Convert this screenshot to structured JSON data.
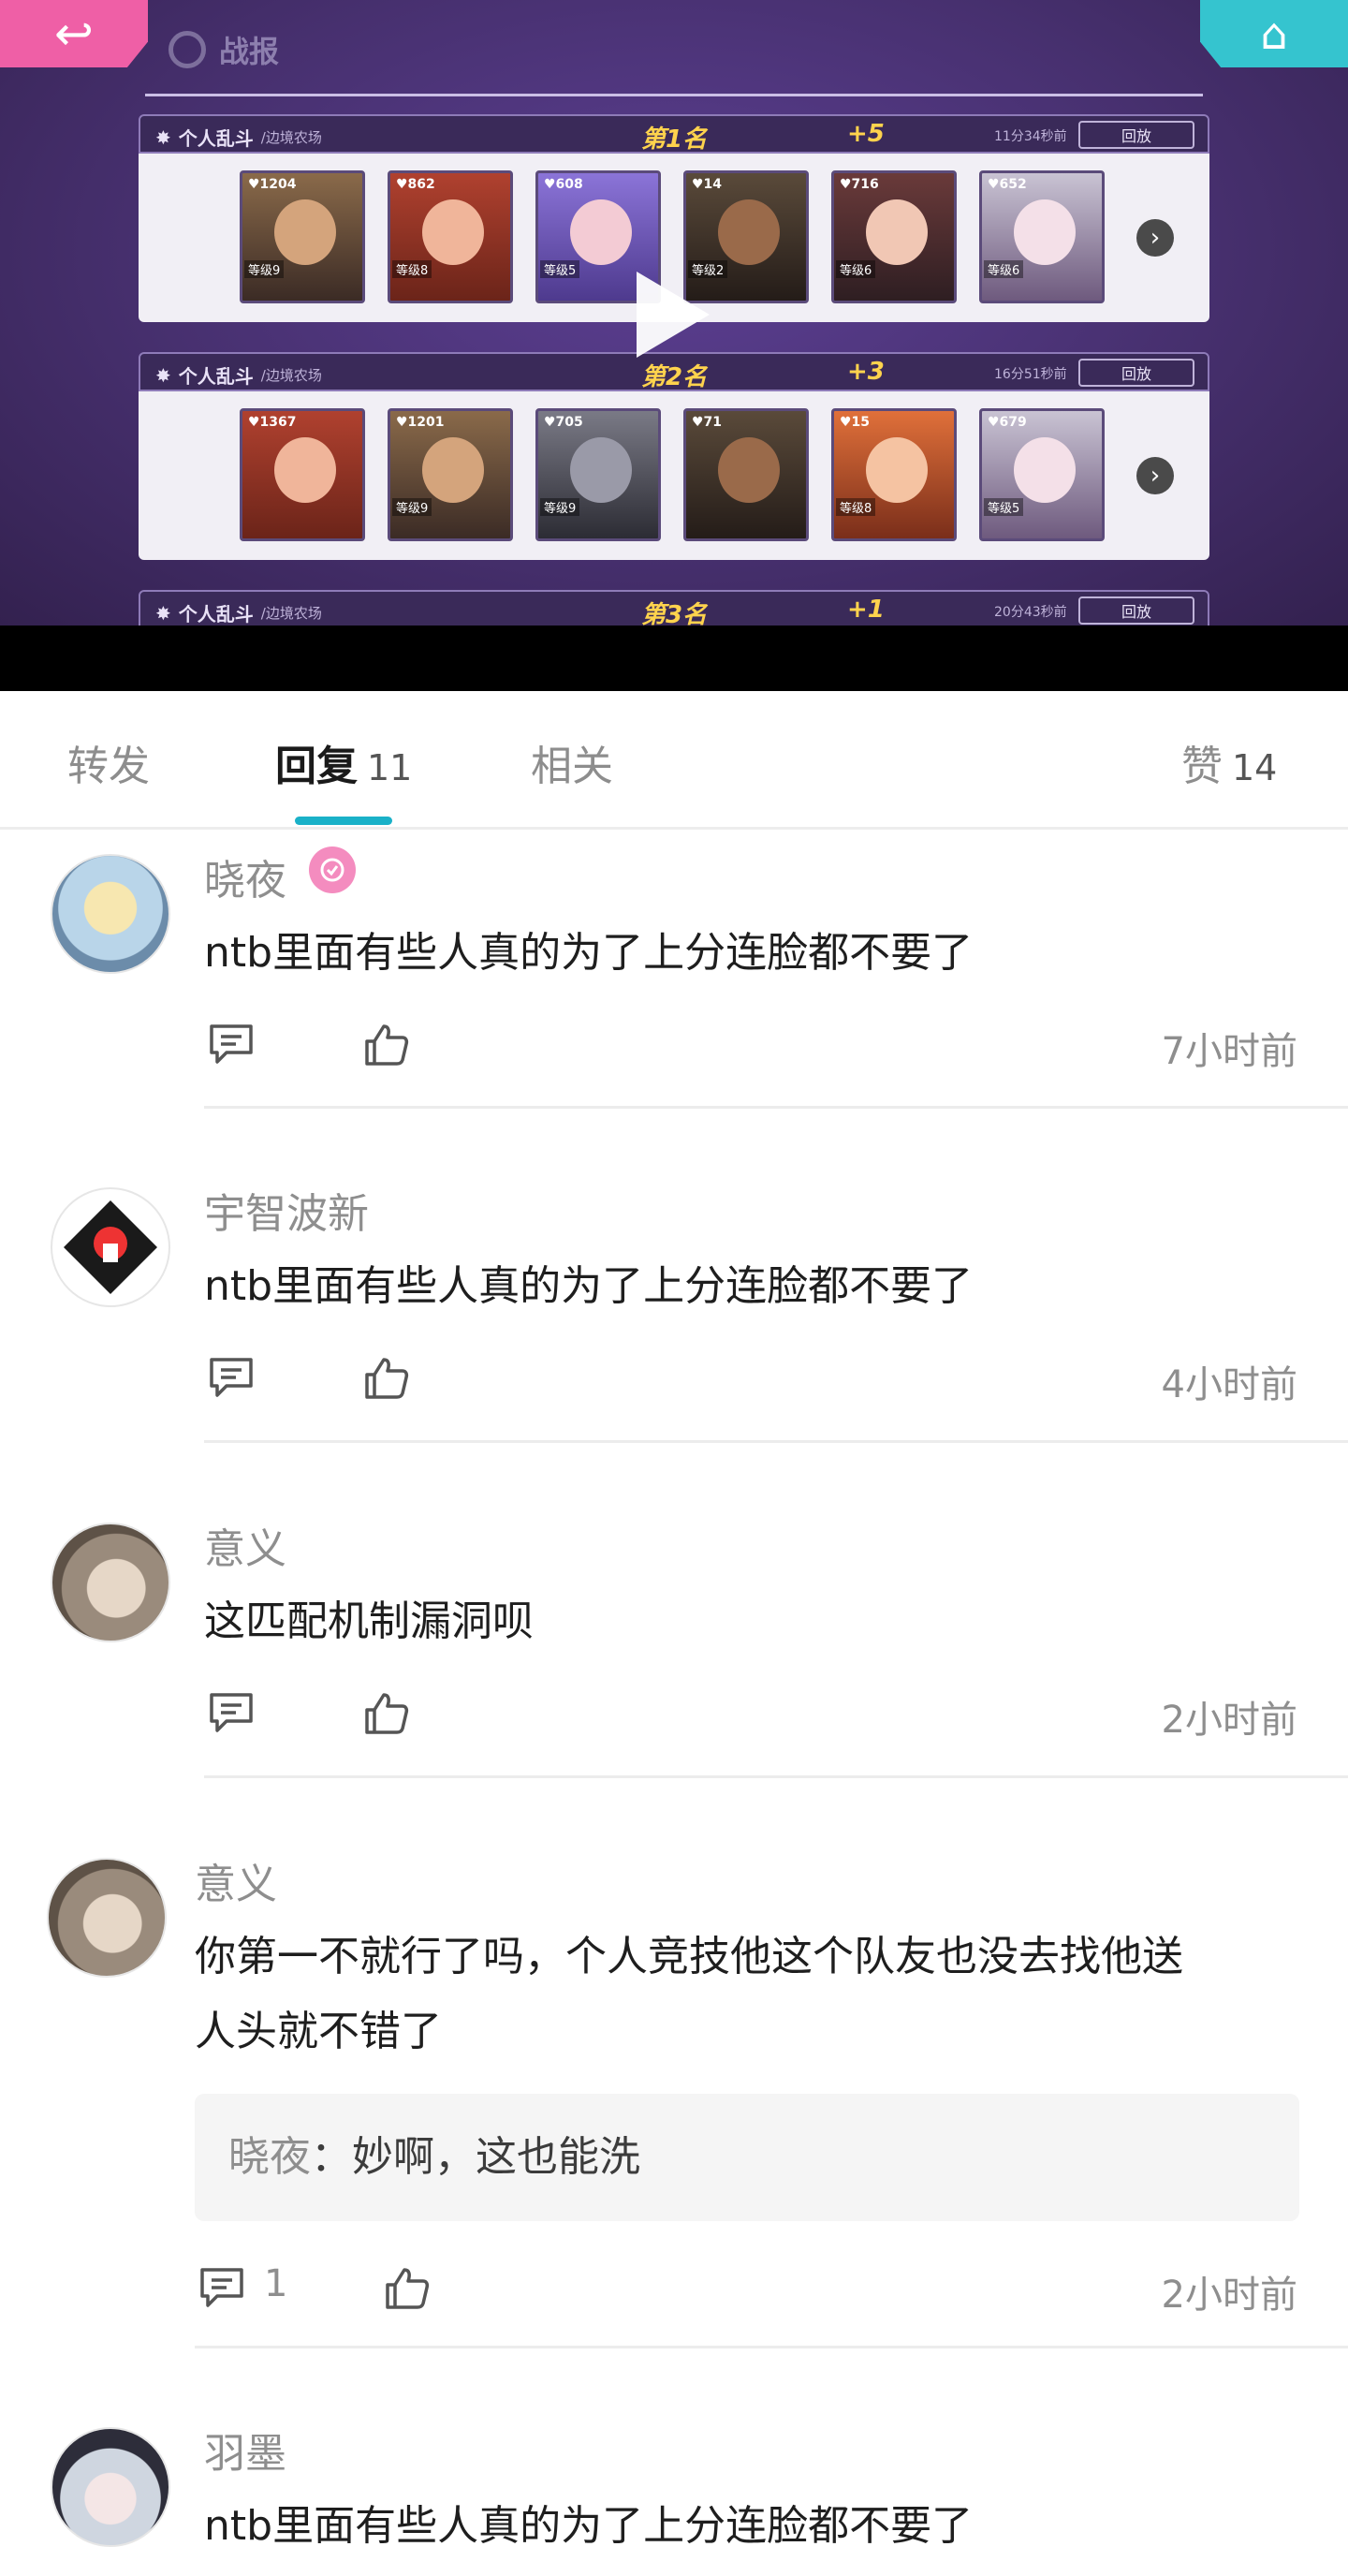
{
  "video": {
    "title": "战报",
    "matches": [
      {
        "mode": "个人乱斗",
        "map": "/边境农场",
        "rank": "第1名",
        "score": "+5",
        "duration": "11分34秒前",
        "replay": "回放",
        "heroes": [
          {
            "hp": "♥1204",
            "lvl": "等级9"
          },
          {
            "hp": "♥862",
            "lvl": "等级8"
          },
          {
            "hp": "♥608",
            "lvl": "等级5"
          },
          {
            "hp": "♥14",
            "lvl": "等级2"
          },
          {
            "hp": "♥716",
            "lvl": "等级6"
          },
          {
            "hp": "♥652",
            "lvl": "等级6"
          }
        ]
      },
      {
        "mode": "个人乱斗",
        "map": "/边境农场",
        "rank": "第2名",
        "score": "+3",
        "duration": "16分51秒前",
        "replay": "回放",
        "heroes": [
          {
            "hp": "♥1367",
            "lvl": ""
          },
          {
            "hp": "♥1201",
            "lvl": "等级9"
          },
          {
            "hp": "♥705",
            "lvl": "等级9"
          },
          {
            "hp": "♥71",
            "lvl": ""
          },
          {
            "hp": "♥15",
            "lvl": "等级8"
          },
          {
            "hp": "♥679",
            "lvl": "等级5"
          }
        ]
      },
      {
        "mode": "个人乱斗",
        "map": "/边境农场",
        "rank": "第3名",
        "score": "+1",
        "duration": "20分43秒前",
        "replay": "回放"
      }
    ]
  },
  "tabs": [
    {
      "label": "转发"
    },
    {
      "label": "回复",
      "count": "11"
    },
    {
      "label": "相关"
    },
    {
      "label": "赞",
      "count": "14"
    }
  ],
  "comments": [
    {
      "author": "晓夜",
      "text": "ntb里面有些人真的为了上分连脸都不要了",
      "time": "7小时前"
    },
    {
      "author": "宇智波新",
      "text": "ntb里面有些人真的为了上分连脸都不要了",
      "time": "4小时前"
    },
    {
      "author": "意义",
      "text": "这匹配机制漏洞呗",
      "time": "2小时前"
    },
    {
      "author": "意义",
      "text_line1": "你第一不就行了吗，个人竞技他这个队友也没去找他送",
      "text_line2": "人头就不错了",
      "quote_author": "晓夜",
      "quote_sep": "：",
      "quote_text": "妙啊，这也能洗",
      "reply_count": "1",
      "time": "2小时前"
    },
    {
      "author": "羽墨",
      "text": "ntb里面有些人真的为了上分连脸都不要了"
    }
  ],
  "colors": {
    "accent": "#1ab1c8",
    "muted": "#8e8e8e",
    "back": "#ef5fa6",
    "home": "#35c4cf"
  }
}
